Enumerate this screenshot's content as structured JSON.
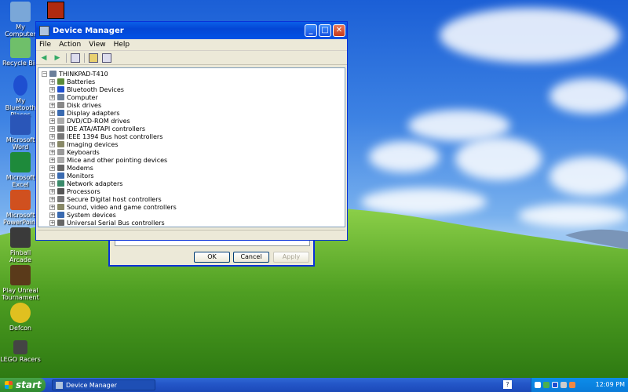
{
  "desktop": {
    "icons": [
      {
        "label": "My Computer",
        "color": "#7aa7d8"
      },
      {
        "label": "Recycle Bin",
        "color": "#6fbf6a"
      },
      {
        "label": "My Bluetooth Places",
        "color": "#1e4fd0"
      },
      {
        "label": "Microsoft Word",
        "color": "#2a56b8"
      },
      {
        "label": "Microsoft Excel",
        "color": "#1e8a3b"
      },
      {
        "label": "Microsoft PowerPoint",
        "color": "#d0501f"
      },
      {
        "label": "Pinball Arcade",
        "color": "#3a3a3a"
      },
      {
        "label": "Play Unreal Tournament",
        "color": "#5a3a1a"
      },
      {
        "label": "Defcon",
        "color": "#e0c020"
      },
      {
        "label": "LEGO Racers",
        "color": "#444444"
      }
    ],
    "top_icon_color": "#b02a10"
  },
  "window": {
    "title": "Device Manager",
    "menu": [
      "File",
      "Action",
      "View",
      "Help"
    ],
    "root": "THINKPAD-T410",
    "devices": [
      "Batteries",
      "Bluetooth Devices",
      "Computer",
      "Disk drives",
      "Display adapters",
      "DVD/CD-ROM drives",
      "IDE ATA/ATAPI controllers",
      "IEEE 1394 Bus host controllers",
      "Imaging devices",
      "Keyboards",
      "Mice and other pointing devices",
      "Modems",
      "Monitors",
      "Network adapters",
      "Processors",
      "Secure Digital host controllers",
      "Sound, video and game controllers",
      "System devices",
      "Universal Serial Bus controllers"
    ],
    "expand_symbol": "+",
    "collapse_symbol": "−"
  },
  "dialog": {
    "ok": "OK",
    "cancel": "Cancel",
    "apply": "Apply"
  },
  "taskbar": {
    "start": "start",
    "task": "Device Manager",
    "help": "?",
    "clock": "12:09 PM"
  }
}
